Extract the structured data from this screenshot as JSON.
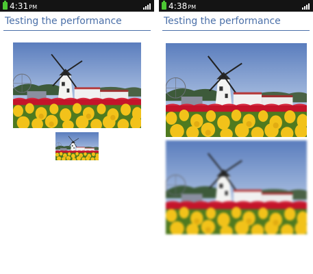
{
  "left_screen": {
    "status": {
      "time": "4:31",
      "ampm": "PM"
    },
    "title": "Testing the performance"
  },
  "right_screen": {
    "status": {
      "time": "4:38",
      "ampm": "PM"
    },
    "title": "Testing the performance"
  },
  "colors": {
    "accent": "#4a6fa8",
    "statusbar": "#141414",
    "battery": "#4cc733",
    "sky_top": "#5d7fbe",
    "sky_bottom": "#c9d7ea",
    "tulip_red": "#c4142a",
    "tulip_yellow": "#f2c21a"
  },
  "icons": [
    "battery-icon",
    "signal-icon"
  ]
}
